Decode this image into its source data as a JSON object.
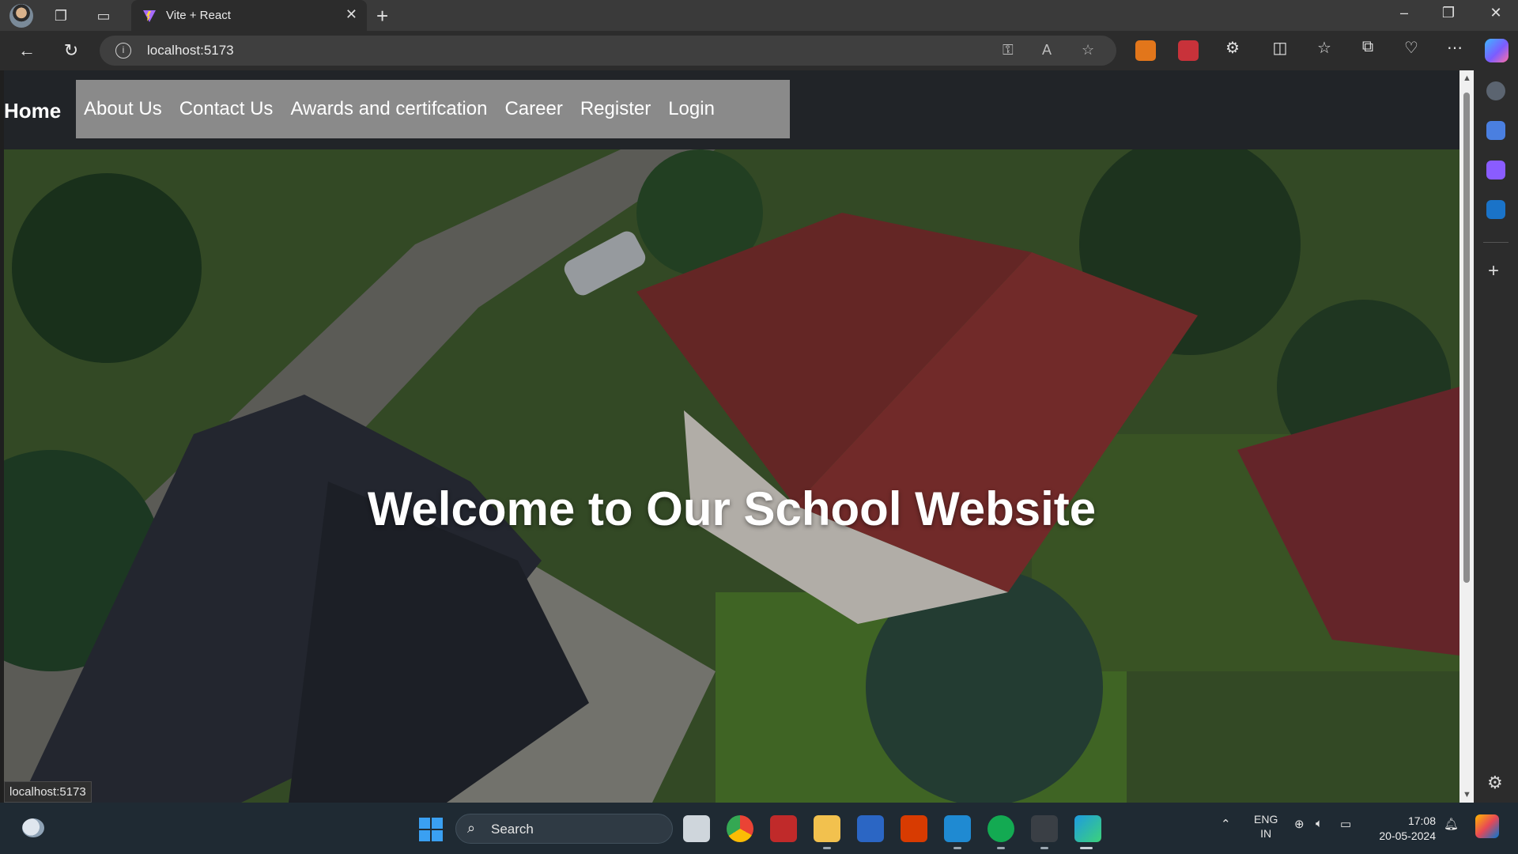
{
  "browser": {
    "tab_title": "Vite + React",
    "url": "localhost:5173",
    "status_url": "localhost:5173"
  },
  "site": {
    "nav": {
      "home": "Home",
      "links": [
        "About Us",
        "Contact Us",
        "Awards and certifcation",
        "Career",
        "Register",
        "Login"
      ]
    },
    "hero_title": "Welcome to Our School Website"
  },
  "taskbar": {
    "search_label": "Search",
    "language": "ENG",
    "region": "IN",
    "time": "17:08",
    "date": "20-05-2024"
  },
  "colors": {
    "nav_bg": "#212428",
    "nav_box": "#8a8a8a",
    "accent": "#3aa0f2"
  }
}
